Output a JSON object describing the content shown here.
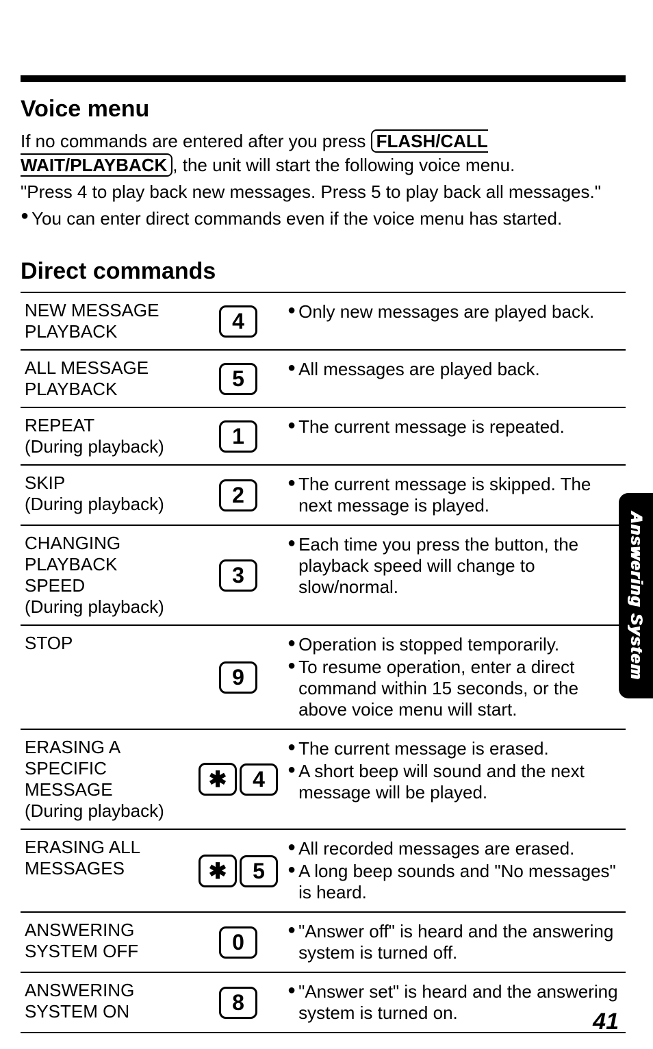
{
  "voice_menu": {
    "heading": "Voice menu",
    "intro_before": "If no commands are entered after you press ",
    "button_label": "FLASH/CALL WAIT/PLAYBACK",
    "intro_after": ", the unit will start the following voice menu.",
    "quote": "\"Press 4 to play back new messages. Press 5 to play back all messages.\"",
    "note": "You can enter direct commands even if the voice menu has started."
  },
  "direct_commands": {
    "heading": "Direct commands",
    "rows": [
      {
        "name_lines": [
          "NEW MESSAGE",
          "PLAYBACK"
        ],
        "keys": [
          "4"
        ],
        "bullets": [
          "Only new messages are played back."
        ]
      },
      {
        "name_lines": [
          "ALL MESSAGE",
          "PLAYBACK"
        ],
        "keys": [
          "5"
        ],
        "bullets": [
          "All messages are played back."
        ]
      },
      {
        "name_lines": [
          "REPEAT",
          "(During playback)"
        ],
        "keys": [
          "1"
        ],
        "bullets": [
          "The current message is repeated."
        ]
      },
      {
        "name_lines": [
          "SKIP",
          "(During playback)"
        ],
        "keys": [
          "2"
        ],
        "bullets": [
          "The current message is skipped. The next message is played."
        ]
      },
      {
        "name_lines": [
          "CHANGING",
          "PLAYBACK",
          "SPEED",
          "(During playback)"
        ],
        "keys": [
          "3"
        ],
        "bullets": [
          "Each time you press the button, the playback speed will change to slow/normal."
        ]
      },
      {
        "name_lines": [
          "STOP"
        ],
        "keys": [
          "9"
        ],
        "bullets": [
          "Operation is stopped temporarily.",
          "To resume operation, enter a direct command within 15 seconds, or the above voice menu will start."
        ]
      },
      {
        "name_lines": [
          "ERASING A",
          "SPECIFIC",
          "MESSAGE",
          "(During playback)"
        ],
        "keys": [
          "✱",
          "4"
        ],
        "bullets": [
          "The current message is erased.",
          "A short beep will sound and the next message will be played."
        ]
      },
      {
        "name_lines": [
          "ERASING ALL",
          "MESSAGES"
        ],
        "keys": [
          "✱",
          "5"
        ],
        "bullets": [
          "All recorded messages are erased.",
          "A long beep sounds and \"No messages\" is heard."
        ]
      },
      {
        "name_lines": [
          "ANSWERING",
          "SYSTEM OFF"
        ],
        "keys": [
          "0"
        ],
        "bullets": [
          "\"Answer off\" is heard and the answering system is turned off."
        ]
      },
      {
        "name_lines": [
          "ANSWERING",
          "SYSTEM ON"
        ],
        "keys": [
          "8"
        ],
        "bullets": [
          "\"Answer set\" is heard and the answering system is turned on."
        ]
      }
    ]
  },
  "side_tab": "Answering System",
  "page_number": "41"
}
